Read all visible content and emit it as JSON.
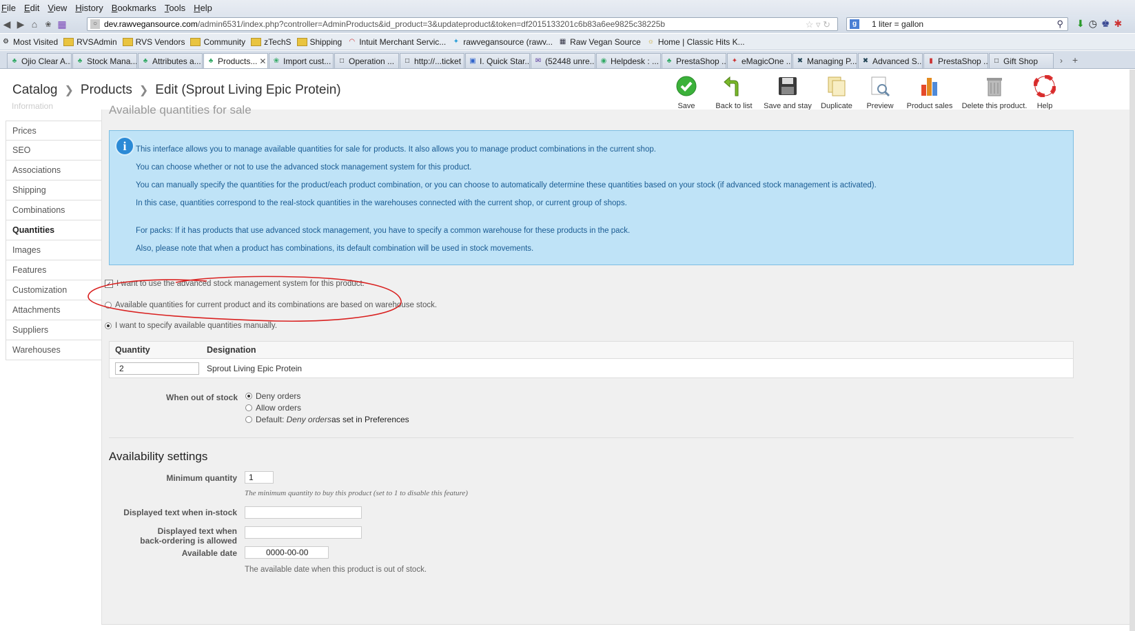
{
  "menu": [
    "File",
    "Edit",
    "View",
    "History",
    "Bookmarks",
    "Tools",
    "Help"
  ],
  "address_bar": {
    "domain": "dev.rawvegansource.com",
    "path": "/admin6531/index.php?controller=AdminProducts&id_product=3&updateproduct&token=df2015133201c6b83a6ee9825c38225b"
  },
  "search_bar": {
    "value": "1 liter = gallon"
  },
  "bookmarks": [
    {
      "label": "Most Visited",
      "icon": "gear-icon"
    },
    {
      "label": "RVSAdmin",
      "icon": "folder-icon"
    },
    {
      "label": "RVS Vendors",
      "icon": "folder-icon"
    },
    {
      "label": "Community",
      "icon": "folder-icon"
    },
    {
      "label": "zTechS",
      "icon": "folder-icon"
    },
    {
      "label": "Shipping",
      "icon": "folder-icon"
    },
    {
      "label": "Intuit Merchant Servic...",
      "icon": "spinner-icon"
    },
    {
      "label": "rawvegansource (rawv...",
      "icon": "twitter-icon"
    },
    {
      "label": "Raw Vegan Source",
      "icon": "grid-icon"
    },
    {
      "label": "Home | Classic Hits K...",
      "icon": "globe-icon"
    }
  ],
  "tabs": [
    {
      "label": "Ojio Clear A...",
      "active": false
    },
    {
      "label": "Stock Mana...",
      "active": false
    },
    {
      "label": "Attributes a...",
      "active": false
    },
    {
      "label": "Products...",
      "active": true
    },
    {
      "label": "Import cust...",
      "active": false
    },
    {
      "label": "Operation ...",
      "active": false
    },
    {
      "label": "http://...ticket",
      "active": false
    },
    {
      "label": "I. Quick Star...",
      "active": false
    },
    {
      "label": "(52448 unre...",
      "active": false
    },
    {
      "label": "Helpdesk : ...",
      "active": false
    },
    {
      "label": "PrestaShop ...",
      "active": false
    },
    {
      "label": "eMagicOne ...",
      "active": false
    },
    {
      "label": "Managing P...",
      "active": false
    },
    {
      "label": "Advanced S...",
      "active": false
    },
    {
      "label": "PrestaShop ...",
      "active": false
    },
    {
      "label": "Gift Shop",
      "active": false
    }
  ],
  "breadcrumb": {
    "catalog": "Catalog",
    "products": "Products",
    "edit": "Edit (Sprout Living Epic Protein)"
  },
  "toolbar": {
    "save": "Save",
    "back": "Back to list",
    "save_stay": "Save and stay",
    "duplicate": "Duplicate",
    "preview": "Preview",
    "sales": "Product sales",
    "delete": "Delete this product.",
    "help": "Help"
  },
  "sidebar": {
    "ghost": "Information",
    "items": [
      "Prices",
      "SEO",
      "Associations",
      "Shipping",
      "Combinations",
      "Quantities",
      "Images",
      "Features",
      "Customization",
      "Attachments",
      "Suppliers",
      "Warehouses"
    ],
    "active": "Quantities"
  },
  "main": {
    "ghost_title": "Available quantities for sale",
    "info_lines": [
      "This interface allows you to manage available quantities for sale for products. It also allows you to manage product combinations in the current shop.",
      "You can choose whether or not to use the advanced stock management system for this product.",
      "You can manually specify the quantities for the product/each product combination, or you can choose to automatically determine these quantities based on your stock (if advanced stock management is activated).",
      "In this case, quantities correspond to the real-stock quantities in the warehouses connected with the current shop, or current group of shops.",
      "For packs: If it has products that use advanced stock management, you have to specify a common warehouse for these products in the pack.",
      "Also, please note that when a product has combinations, its default combination will be used in stock movements."
    ],
    "advanced_stock_checkbox": "I want to use the advanced stock management system for this product.",
    "radio_warehouse": "Available quantities for current product and its combinations are based on warehouse stock.",
    "radio_manual": "I want to specify available quantities manually.",
    "table": {
      "col_quantity": "Quantity",
      "col_designation": "Designation",
      "quantity": "2",
      "designation": "Sprout Living Epic Protein"
    },
    "out_of_stock": {
      "label": "When out of stock",
      "deny": "Deny orders",
      "allow": "Allow orders",
      "default_prefix": "Default: ",
      "default_italic": "Deny orders",
      "default_suffix": " as set in Preferences"
    },
    "availability": {
      "title": "Availability settings",
      "min_qty_label": "Minimum quantity",
      "min_qty": "1",
      "min_qty_hint": "The minimum quantity to buy this product (set to 1 to disable this feature)",
      "in_stock_label": "Displayed text when in-stock",
      "in_stock_value": "",
      "backorder_label_1": "Displayed text when",
      "backorder_label_2": "back-ordering is allowed",
      "backorder_value": "",
      "date_label": "Available date",
      "date_value": "0000-00-00",
      "date_hint": "The available date when this product is out of stock."
    }
  },
  "colors": {
    "annotation_circle": "#d9201f",
    "info_bg": "#bfe3f7",
    "info_text": "#1a5b92"
  }
}
